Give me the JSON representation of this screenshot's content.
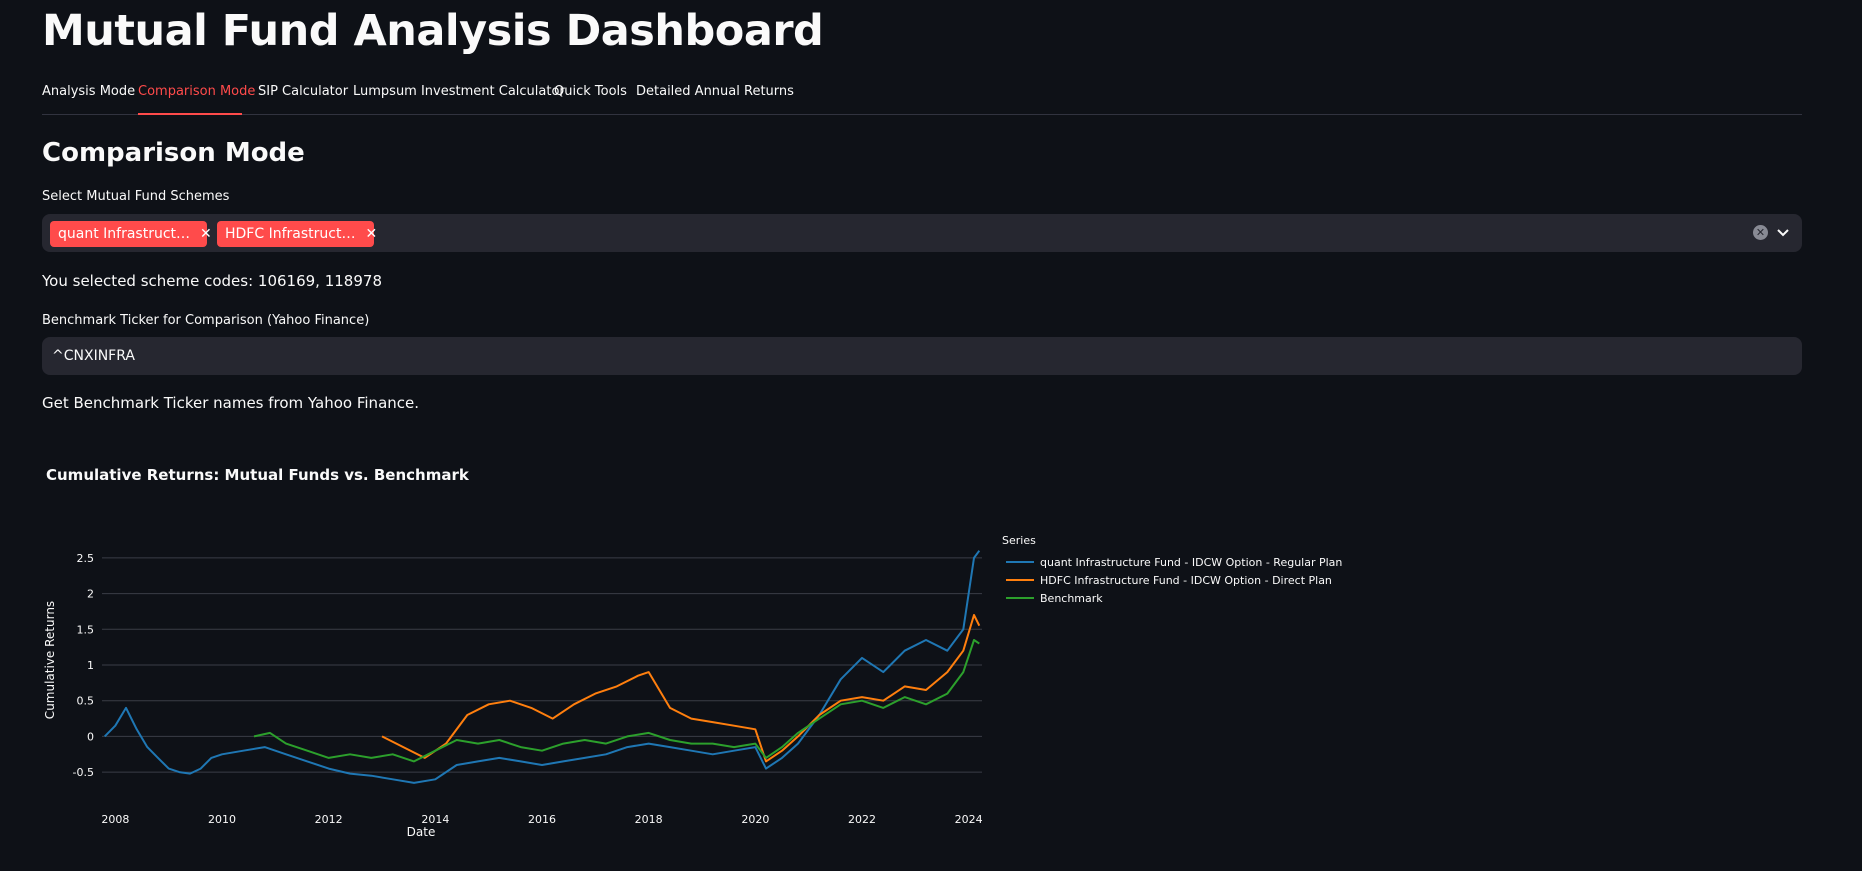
{
  "header": {
    "title": "Mutual Fund Analysis Dashboard"
  },
  "tabs": [
    {
      "label": "Analysis Mode",
      "active": false
    },
    {
      "label": "Comparison Mode",
      "active": true
    },
    {
      "label": "SIP Calculator",
      "active": false
    },
    {
      "label": "Lumpsum Investment Calculator",
      "active": false
    },
    {
      "label": "Quick Tools",
      "active": false
    },
    {
      "label": "Detailed Annual Returns",
      "active": false
    }
  ],
  "main": {
    "section_title": "Comparison Mode",
    "schemes_label": "Select Mutual Fund Schemes",
    "selected_schemes": [
      {
        "label": "quant Infrastruct…"
      },
      {
        "label": "HDFC Infrastruct…"
      }
    ],
    "clear_icon": "clear-icon",
    "dropdown_icon": "chevron-down-icon",
    "selected_codes_text": "You selected scheme codes: 106169, 118978",
    "benchmark_label": "Benchmark Ticker for Comparison (Yahoo Finance)",
    "benchmark_value": "^CNXINFRA",
    "benchmark_note": "Get Benchmark Ticker names from Yahoo Finance."
  },
  "colors": {
    "accent": "#ff4b4b",
    "background": "#0e1117",
    "input_bg": "#262730",
    "series_quant": "#1f77b4",
    "series_hdfc": "#ff7f0e",
    "series_benchmark": "#2ca02c"
  },
  "chart_data": {
    "type": "line",
    "title": "Cumulative Returns: Mutual Funds vs. Benchmark",
    "xlabel": "Date",
    "ylabel": "Cumulative Returns",
    "xlim": [
      2007.75,
      2024.25
    ],
    "ylim": [
      -0.75,
      2.75
    ],
    "x_ticks": [
      2008,
      2010,
      2012,
      2014,
      2016,
      2018,
      2020,
      2022,
      2024
    ],
    "y_ticks": [
      -0.5,
      0,
      0.5,
      1,
      1.5,
      2,
      2.5
    ],
    "grid": true,
    "legend_title": "Series",
    "legend_position": "right",
    "series": [
      {
        "name": "quant Infrastructure Fund - IDCW Option - Regular Plan",
        "color": "#1f77b4",
        "x": [
          2007.8,
          2008.0,
          2008.2,
          2008.4,
          2008.6,
          2008.8,
          2009.0,
          2009.2,
          2009.4,
          2009.6,
          2009.8,
          2010.0,
          2010.4,
          2010.8,
          2011.2,
          2011.6,
          2012.0,
          2012.4,
          2012.8,
          2013.2,
          2013.6,
          2014.0,
          2014.4,
          2014.8,
          2015.2,
          2015.6,
          2016.0,
          2016.4,
          2016.8,
          2017.2,
          2017.6,
          2018.0,
          2018.4,
          2018.8,
          2019.2,
          2019.6,
          2020.0,
          2020.2,
          2020.5,
          2020.8,
          2021.2,
          2021.6,
          2022.0,
          2022.4,
          2022.8,
          2023.2,
          2023.6,
          2023.9,
          2024.1,
          2024.2
        ],
        "values": [
          0.0,
          0.15,
          0.4,
          0.1,
          -0.15,
          -0.3,
          -0.45,
          -0.5,
          -0.52,
          -0.45,
          -0.3,
          -0.25,
          -0.2,
          -0.15,
          -0.25,
          -0.35,
          -0.45,
          -0.52,
          -0.55,
          -0.6,
          -0.65,
          -0.6,
          -0.4,
          -0.35,
          -0.3,
          -0.35,
          -0.4,
          -0.35,
          -0.3,
          -0.25,
          -0.15,
          -0.1,
          -0.15,
          -0.2,
          -0.25,
          -0.2,
          -0.15,
          -0.45,
          -0.3,
          -0.1,
          0.3,
          0.8,
          1.1,
          0.9,
          1.2,
          1.35,
          1.2,
          1.5,
          2.5,
          2.6
        ]
      },
      {
        "name": "HDFC Infrastructure Fund - IDCW Option - Direct Plan",
        "color": "#ff7f0e",
        "x": [
          2013.0,
          2013.4,
          2013.8,
          2014.2,
          2014.6,
          2015.0,
          2015.4,
          2015.8,
          2016.2,
          2016.6,
          2017.0,
          2017.4,
          2017.8,
          2018.0,
          2018.4,
          2018.8,
          2019.2,
          2019.6,
          2020.0,
          2020.2,
          2020.5,
          2020.8,
          2021.2,
          2021.6,
          2022.0,
          2022.4,
          2022.8,
          2023.2,
          2023.6,
          2023.9,
          2024.1,
          2024.2
        ],
        "values": [
          0.0,
          -0.15,
          -0.3,
          -0.1,
          0.3,
          0.45,
          0.5,
          0.4,
          0.25,
          0.45,
          0.6,
          0.7,
          0.85,
          0.9,
          0.4,
          0.25,
          0.2,
          0.15,
          0.1,
          -0.35,
          -0.2,
          0.0,
          0.3,
          0.5,
          0.55,
          0.5,
          0.7,
          0.65,
          0.9,
          1.2,
          1.7,
          1.55
        ]
      },
      {
        "name": "Benchmark",
        "color": "#2ca02c",
        "x": [
          2010.6,
          2010.9,
          2011.2,
          2011.6,
          2012.0,
          2012.4,
          2012.8,
          2013.2,
          2013.6,
          2014.0,
          2014.4,
          2014.8,
          2015.2,
          2015.6,
          2016.0,
          2016.4,
          2016.8,
          2017.2,
          2017.6,
          2018.0,
          2018.4,
          2018.8,
          2019.2,
          2019.6,
          2020.0,
          2020.2,
          2020.5,
          2020.8,
          2021.2,
          2021.6,
          2022.0,
          2022.4,
          2022.8,
          2023.2,
          2023.6,
          2023.9,
          2024.1,
          2024.2
        ],
        "values": [
          0.0,
          0.05,
          -0.1,
          -0.2,
          -0.3,
          -0.25,
          -0.3,
          -0.25,
          -0.35,
          -0.2,
          -0.05,
          -0.1,
          -0.05,
          -0.15,
          -0.2,
          -0.1,
          -0.05,
          -0.1,
          0.0,
          0.05,
          -0.05,
          -0.1,
          -0.1,
          -0.15,
          -0.1,
          -0.3,
          -0.15,
          0.05,
          0.25,
          0.45,
          0.5,
          0.4,
          0.55,
          0.45,
          0.6,
          0.9,
          1.35,
          1.3
        ]
      }
    ]
  }
}
